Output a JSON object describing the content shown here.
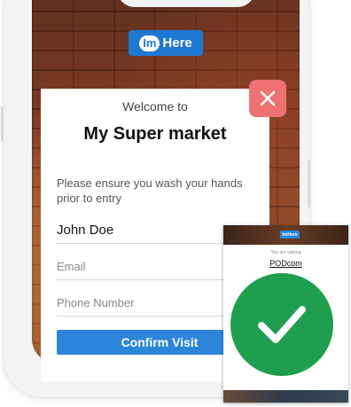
{
  "app": {
    "logo_badge": "Im",
    "logo_text": "Here"
  },
  "modal": {
    "welcome": "Welcome to",
    "title": "My Super market",
    "note": "Please ensure you wash your hands prior to entry",
    "name_value": "John Doe",
    "email_placeholder": "Email",
    "phone_placeholder": "Phone Number",
    "confirm_label": "Confirm Visit"
  },
  "success": {
    "logo": "ImHere",
    "visiting_text": "You are visiting",
    "place": "PODcom"
  },
  "colors": {
    "brand": "#1f78d1",
    "button": "#2b86d9",
    "close": "#ef7272",
    "success": "#1f9e4f"
  },
  "icons": {
    "close": "close-icon",
    "check": "checkmark-icon"
  }
}
